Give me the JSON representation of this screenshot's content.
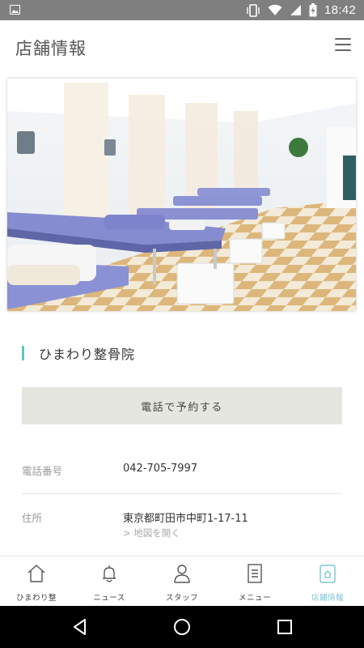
{
  "status_bar": {
    "time": "18:42",
    "icons": [
      "gallery-icon",
      "vibrate-icon",
      "wifi-icon",
      "signal-icon",
      "battery-charging-icon"
    ]
  },
  "header": {
    "title": "店舗情報",
    "menu_icon": "hamburger-menu-icon"
  },
  "hero": {
    "description": "clinic-treatment-room-photo"
  },
  "clinic": {
    "name": "ひまわり整骨院",
    "call_button": "電話で予約する",
    "phone_label": "電話番号",
    "phone": "042-705-7997",
    "address_label": "住所",
    "address": "東京都町田市中町1-17-11",
    "map_link": "> 地図を開く"
  },
  "tabs": [
    {
      "label": "ひまわり整",
      "icon": "home-icon",
      "active": false
    },
    {
      "label": "ニュース",
      "icon": "bell-icon",
      "active": false
    },
    {
      "label": "スタッフ",
      "icon": "person-icon",
      "active": false
    },
    {
      "label": "メニュー",
      "icon": "document-icon",
      "active": false
    },
    {
      "label": "店舗情報",
      "icon": "store-icon",
      "active": true
    }
  ],
  "colors": {
    "accent": "#63c1c6",
    "active_tab": "#7fc3d6",
    "status_bar": "#7f7f7f",
    "button_bg": "#e6e6e1"
  }
}
